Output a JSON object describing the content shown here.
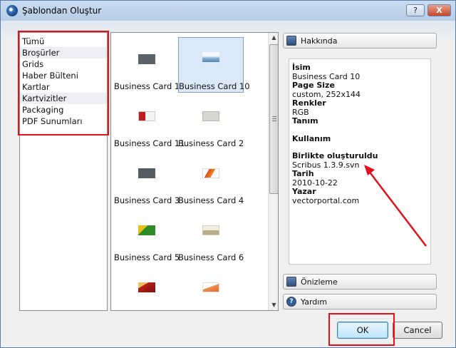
{
  "window": {
    "title": "Şablondan Oluştur",
    "help_label": "?",
    "close_label": "X"
  },
  "categories": {
    "items": [
      {
        "label": "Tümü",
        "selected": false
      },
      {
        "label": "Broşürler",
        "selected": true
      },
      {
        "label": "Grids",
        "selected": false
      },
      {
        "label": "Haber Bülteni",
        "selected": false
      },
      {
        "label": "Kartlar",
        "selected": false
      },
      {
        "label": "Kartvizitler",
        "selected": true
      },
      {
        "label": "Packaging",
        "selected": false
      },
      {
        "label": "PDF Sunumları",
        "selected": false
      }
    ]
  },
  "templates": [
    {
      "label": "Business Card 1",
      "selected": false
    },
    {
      "label": "Business Card 10",
      "selected": true
    },
    {
      "label": "Business Card 11",
      "selected": false
    },
    {
      "label": "Business Card 2",
      "selected": false
    },
    {
      "label": "Business Card 3",
      "selected": false
    },
    {
      "label": "Business Card 4",
      "selected": false
    },
    {
      "label": "Business Card 5",
      "selected": false
    },
    {
      "label": "Business Card 6",
      "selected": false
    },
    {
      "label": "",
      "selected": false
    },
    {
      "label": "",
      "selected": false
    }
  ],
  "sections": {
    "about": "Hakkında",
    "preview": "Önizleme",
    "help": "Yardım"
  },
  "info": {
    "name_label": "İsim",
    "name_value": "Business Card 10",
    "page_size_label": "Page Size",
    "page_size_value": "custom, 252x144",
    "colors_label": "Renkler",
    "colors_value": "RGB",
    "description_label": "Tanım",
    "usage_label": "Kullanım",
    "created_with_label": "Birlikte oluşturuldu",
    "created_with_value": "Scribus 1.3.9.svn",
    "date_label": "Tarih",
    "date_value": "2010-10-22",
    "author_label": "Yazar",
    "author_value": "vectorportal.com"
  },
  "buttons": {
    "ok": "OK",
    "cancel": "Cancel"
  },
  "colors": {
    "annotation_red": "#e0131b",
    "selection_blue": "#dbe9f8"
  }
}
